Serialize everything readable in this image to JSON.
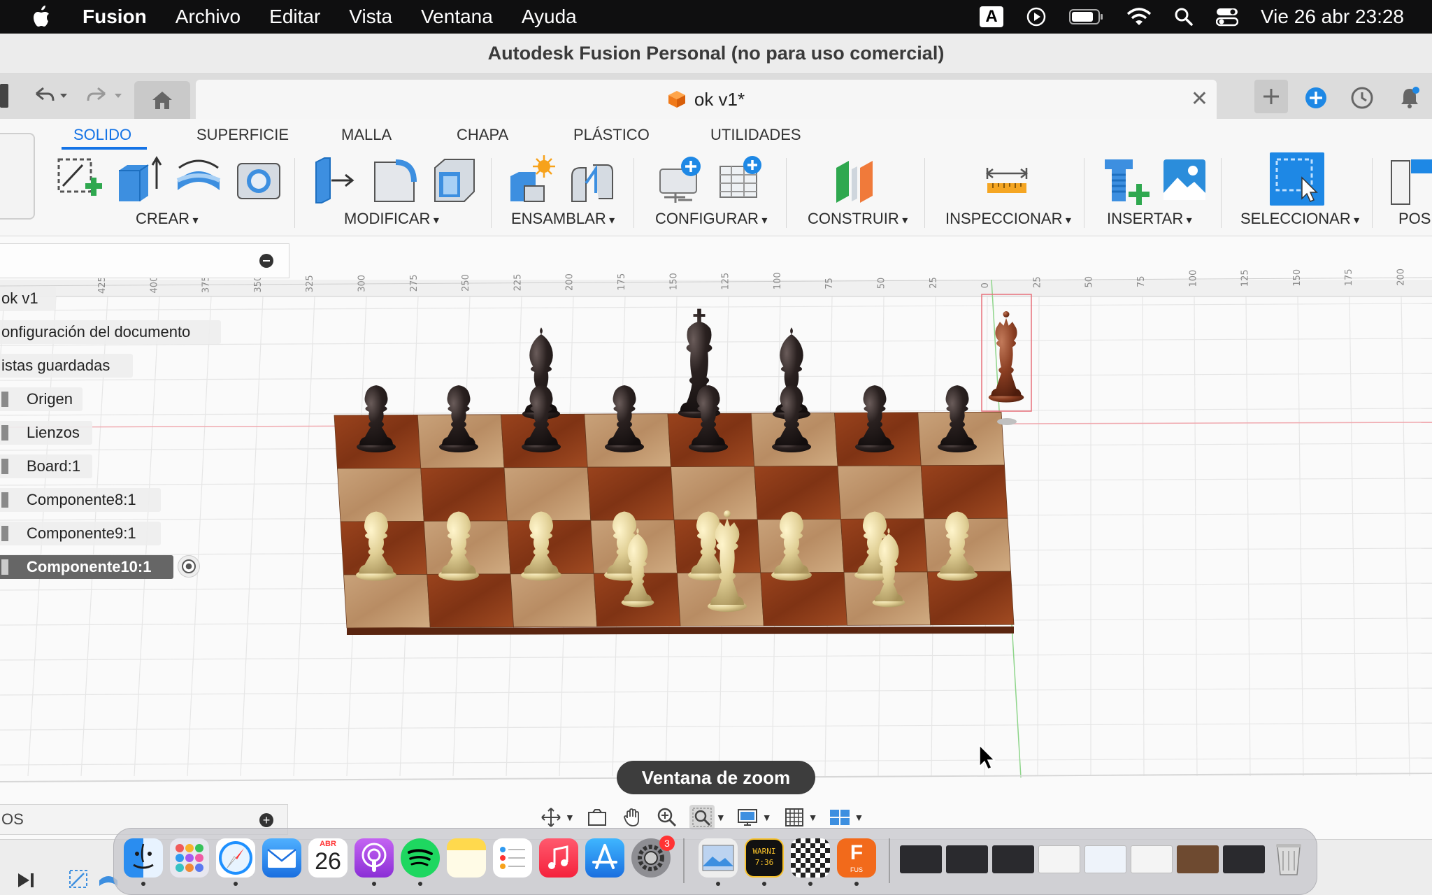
{
  "menubar": {
    "app_name": "Fusion",
    "items": [
      "Archivo",
      "Editar",
      "Vista",
      "Ventana",
      "Ayuda"
    ],
    "input_source": "A",
    "clock": "Vie 26 abr 23:28"
  },
  "window": {
    "title": "Autodesk Fusion Personal (no para uso comercial)"
  },
  "document_tab": {
    "name": "ok v1*",
    "close": "✕"
  },
  "ribbon": {
    "tabs": [
      "SOLIDO",
      "SUPERFICIE",
      "MALLA",
      "CHAPA",
      "PLÁSTICO",
      "UTILIDADES"
    ],
    "active_tab": "SOLIDO",
    "groups": [
      "CREAR",
      "MODIFICAR",
      "ENSAMBLAR",
      "CONFIGURAR",
      "CONSTRUIR",
      "INSPECCIONAR",
      "INSERTAR",
      "SELECCIONAR",
      "POSI"
    ]
  },
  "browser": {
    "items": [
      {
        "label": "ok v1"
      },
      {
        "label": "onfiguración del documento"
      },
      {
        "label": "istas guardadas"
      },
      {
        "label": "Origen"
      },
      {
        "label": "Lienzos"
      },
      {
        "label": "Board:1"
      },
      {
        "label": "Componente8:1"
      },
      {
        "label": "Componente9:1"
      },
      {
        "label": "Componente10:1",
        "selected": true
      }
    ]
  },
  "ruler": {
    "labels": [
      "425",
      "400",
      "375",
      "350",
      "325",
      "300",
      "275",
      "250",
      "225",
      "200",
      "175",
      "150",
      "125",
      "100",
      "75",
      "50",
      "25",
      "0",
      "25",
      "50",
      "75",
      "100",
      "125",
      "150",
      "175",
      "200"
    ]
  },
  "tooltip": "Ventana de zoom",
  "bottom_panel": {
    "label": "OS"
  },
  "dock": {
    "calendar_month": "ABR",
    "calendar_day": "26",
    "badge_count": "3",
    "warning_thumb": "WARNI",
    "warning_time": "7:36",
    "fusion_label": "FUS"
  },
  "colors": {
    "accent": "#1473e6",
    "menubar_bg": "#0f0f10",
    "board_dark": "#8b3a1a",
    "board_light": "#c9a27a",
    "black_piece": "#1e1717",
    "white_piece": "#e6d59c"
  }
}
